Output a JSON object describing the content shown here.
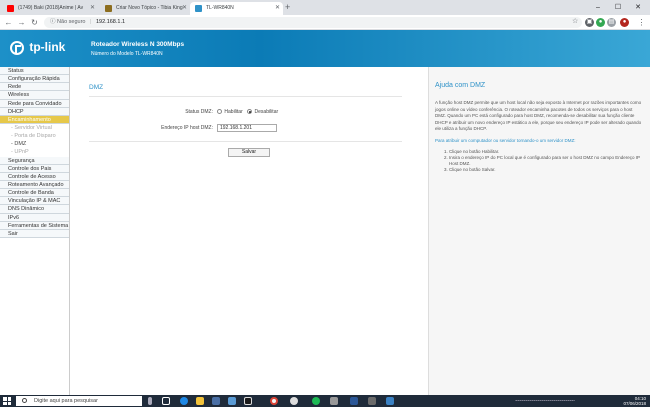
{
  "browser": {
    "tabs": [
      {
        "title": "(1749) Baki (2018)Anime | Av",
        "favicon_color": "#ff0000"
      },
      {
        "title": "Criar Novo Tópico - Tibia King",
        "favicon_color": "#8c6d1f"
      },
      {
        "title": "TL-WR840N",
        "favicon_color": "#2f92c8"
      }
    ],
    "new_tab": "+",
    "address": {
      "security": "Não seguro",
      "url": "192.168.1.1"
    },
    "controls": {
      "minimize": "–",
      "maximize": "☐",
      "close": "✕"
    }
  },
  "router": {
    "logo": "tp-link",
    "title": "Roteador Wireless N 300Mbps",
    "model": "Número do Modelo TL-WR840N"
  },
  "sidebar": {
    "items": [
      {
        "label": "Status",
        "type": "main"
      },
      {
        "label": "Configuração Rápida",
        "type": "main"
      },
      {
        "label": "Rede",
        "type": "main"
      },
      {
        "label": "Wireless",
        "type": "main"
      },
      {
        "label": "Rede para Convidado",
        "type": "main"
      },
      {
        "label": "DHCP",
        "type": "main"
      },
      {
        "label": "Encaminhamento",
        "type": "active"
      },
      {
        "label": "- Servidor Virtual",
        "type": "sub"
      },
      {
        "label": "- Porta de Disparo",
        "type": "sub"
      },
      {
        "label": "- DMZ",
        "type": "sub-selected"
      },
      {
        "label": "- UPnP",
        "type": "sub"
      },
      {
        "label": "Segurança",
        "type": "main"
      },
      {
        "label": "Controle dos Pais",
        "type": "main"
      },
      {
        "label": "Controle de Acesso",
        "type": "main"
      },
      {
        "label": "Roteamento Avançado",
        "type": "main"
      },
      {
        "label": "Controle de Banda",
        "type": "main"
      },
      {
        "label": "Vinculação IP & MAC",
        "type": "main"
      },
      {
        "label": "DNS Dinâmico",
        "type": "main"
      },
      {
        "label": "IPv6",
        "type": "main"
      },
      {
        "label": "Ferramentas de Sistema",
        "type": "main"
      },
      {
        "label": "Sair",
        "type": "main"
      }
    ]
  },
  "dmz": {
    "title": "DMZ",
    "status_label": "Status DMZ:",
    "enable_label": "Habilitar",
    "disable_label": "Desabilitar",
    "selected": "disable",
    "host_ip_label": "Endereço IP host DMZ:",
    "host_ip_value": "192.168.1.201",
    "save_label": "Salvar"
  },
  "help": {
    "title": "Ajuda com DMZ",
    "body": "A função host DMZ permite que um host local não seja exposto à Internet por razões importantes como jogos online ou vídeo conferência. O roteador encaminha pacotes de todos os serviços para o host DMZ. Quando um PC está configurado para host DMZ, recomenda-se desabilitar sua função cliente DHCP e atribuir um novo endereço IP estático a ele, porque seu endereço IP pode ser alterado quando ele utiliza a função DHCP.",
    "howto_title": "Para atribuir um computador ou servidor tornando-o um servidor DMZ:",
    "steps": [
      "Clique no botão Habilitar.",
      "Insira o endereço IP do PC local que é configurado para ser o host DMZ no campo Endereço IP Host DMZ.",
      "Clique no botão Salvar."
    ]
  },
  "taskbar": {
    "search_placeholder": "Digite aqui para pesquisar",
    "time": "04:10",
    "date": "07/06/2018"
  }
}
